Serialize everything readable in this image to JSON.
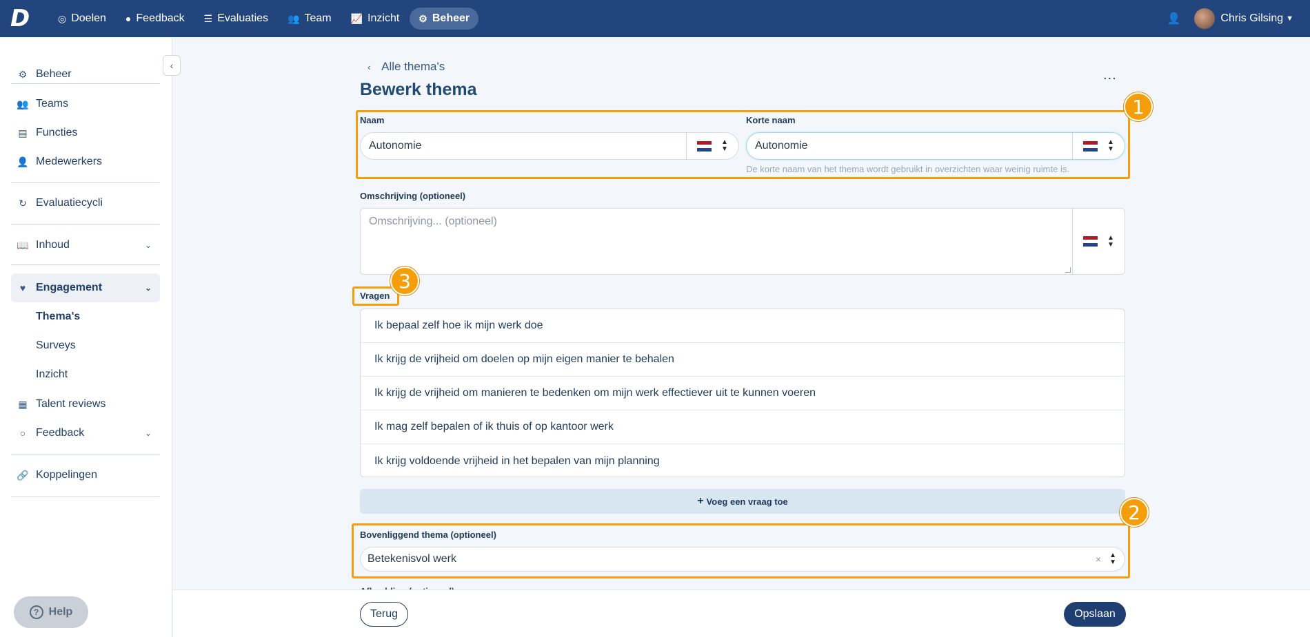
{
  "nav": {
    "logo": "D",
    "items": [
      {
        "label": "Doelen",
        "icon": "target-icon"
      },
      {
        "label": "Feedback",
        "icon": "speech-bubble-icon"
      },
      {
        "label": "Evaluaties",
        "icon": "list-icon"
      },
      {
        "label": "Team",
        "icon": "users-icon"
      },
      {
        "label": "Inzicht",
        "icon": "chart-icon"
      },
      {
        "label": "Beheer",
        "icon": "gear-icon",
        "active": true
      }
    ],
    "user_name": "Chris Gilsing"
  },
  "sidebar": {
    "items": {
      "beheer": "Beheer",
      "teams": "Teams",
      "functies": "Functies",
      "medewerkers": "Medewerkers",
      "evaluatiecycli": "Evaluatiecycli",
      "inhoud": "Inhoud",
      "engagement": "Engagement",
      "themas": "Thema's",
      "surveys": "Surveys",
      "inzicht": "Inzicht",
      "talent_reviews": "Talent reviews",
      "feedback": "Feedback",
      "koppelingen": "Koppelingen"
    },
    "help": "Help"
  },
  "page": {
    "back_label": "Alle thema's",
    "title": "Bewerk thema",
    "more": "..."
  },
  "form": {
    "naam_label": "Naam",
    "naam_value": "Autonomie",
    "korte_naam_label": "Korte naam",
    "korte_naam_value": "Autonomie",
    "korte_naam_hint": "De korte naam van het thema wordt gebruikt in overzichten waar weinig ruimte is.",
    "omschrijving_label": "Omschrijving (optioneel)",
    "omschrijving_placeholder": "Omschrijving... (optioneel)",
    "vragen_label": "Vragen",
    "questions": [
      "Ik bepaal zelf hoe ik mijn werk doe",
      "Ik krijg de vrijheid om doelen op mijn eigen manier te behalen",
      "Ik krijg de vrijheid om manieren te bedenken om mijn werk effectiever uit te kunnen voeren",
      "Ik mag zelf bepalen of ik thuis of op kantoor werk",
      "Ik krijg voldoende vrijheid in het bepalen van mijn planning"
    ],
    "add_question": "Voeg een vraag toe",
    "parent_label": "Bovenliggend thema (optioneel)",
    "parent_value": "Betekenisvol werk",
    "clear": "×",
    "partial_label": "Afbeelding (optioneel)"
  },
  "footer": {
    "back": "Terug",
    "save": "Opslaan"
  },
  "annotations": [
    "1",
    "2",
    "3"
  ],
  "colors": {
    "topbar": "#22457d",
    "highlight": "#f59e0b",
    "primary_button": "#1f3f72"
  }
}
